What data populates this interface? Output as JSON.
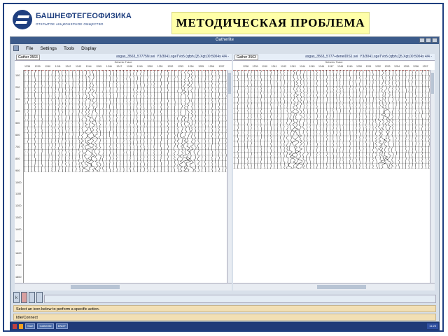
{
  "logo": {
    "name": "БАШНЕФТЕГЕОФИЗИКА",
    "subtitle": "ОТКРЫТОЕ АКЦИОНЕРНОЕ ОБЩЕСТВО"
  },
  "slide_title": "МЕТОДИЧЕСКАЯ ПРОБЛЕМА",
  "window": {
    "title": "Gatherlite",
    "menu": [
      "File",
      "Settings",
      "Tools",
      "Display"
    ]
  },
  "panes": {
    "left": {
      "gather_label": "Gather 3563",
      "file_label": "asgas_3563_57775N.sei",
      "file_label2": "Y3/3041.sgeTVo5 (qfph,Q5.Xgt,00:5004s 4/4 -",
      "sub_label": "Seismic    Trace",
      "ticks": [
        "1238",
        "1239",
        "1240",
        "1241",
        "1242",
        "1243",
        "1244",
        "1245",
        "1246",
        "1247",
        "1248",
        "1249",
        "1250",
        "1251",
        "1252",
        "1253",
        "1254",
        "1255",
        "1256",
        "1257"
      ]
    },
    "right": {
      "gather_label": "Gather 3563",
      "file_label": "asgas_3563_5777+deneiDIS1.sei",
      "file_label2": "Y3/3041.sgeTVo5 (qfph,Q5.Xgt,00:5004s 4/4 -",
      "sub_label": "Seismic    Trace",
      "ticks": [
        "1238",
        "1239",
        "1240",
        "1241",
        "1242",
        "1243",
        "1244",
        "1245",
        "1246",
        "1247",
        "1248",
        "1249",
        "1250",
        "1251",
        "1252",
        "1253",
        "1254",
        "1255",
        "1256",
        "1257"
      ]
    },
    "time_ticks": [
      "100",
      "200",
      "300",
      "400",
      "500",
      "600",
      "700",
      "800",
      "900",
      "1000",
      "1100",
      "1200",
      "1300",
      "1400",
      "1500",
      "1600",
      "1700",
      "1800"
    ]
  },
  "status": {
    "line1": "Select an icon below to perform a specific action.",
    "line2": "Idle/Connect"
  },
  "taskbar": {
    "items": [
      "Start",
      "Gatherlite",
      "BNGF"
    ],
    "clock": "11:25"
  }
}
